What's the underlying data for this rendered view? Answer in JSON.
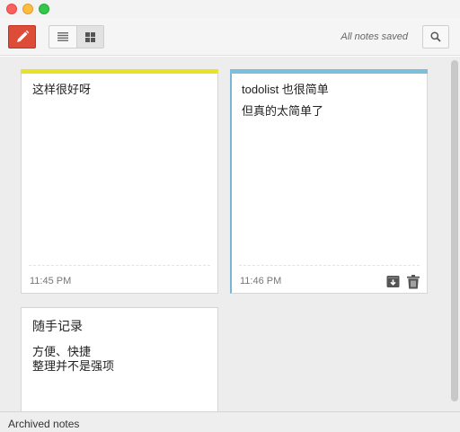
{
  "toolbar": {
    "status": "All notes saved"
  },
  "notes": [
    {
      "lines": [
        "这样很好呀"
      ],
      "time": "11:45 PM"
    },
    {
      "title": "todolist 也很简单",
      "lines": [
        "但真的太简单了"
      ],
      "time": "11:46 PM"
    },
    {
      "title": "随手记录",
      "lines": [
        "方便、快捷",
        "整理并不是强项"
      ]
    }
  ],
  "footer": {
    "archived_label": "Archived notes"
  },
  "colors": {
    "new_button": "#dd4b39",
    "note_yellow_stripe": "#e8e22a",
    "note_blue_stripe": "#7bbfdd"
  },
  "icons": {
    "new_note": "pencil-icon",
    "list_view": "list-view-icon",
    "grid_view": "grid-view-icon",
    "search": "search-icon",
    "archive": "archive-icon",
    "delete": "trash-icon"
  }
}
